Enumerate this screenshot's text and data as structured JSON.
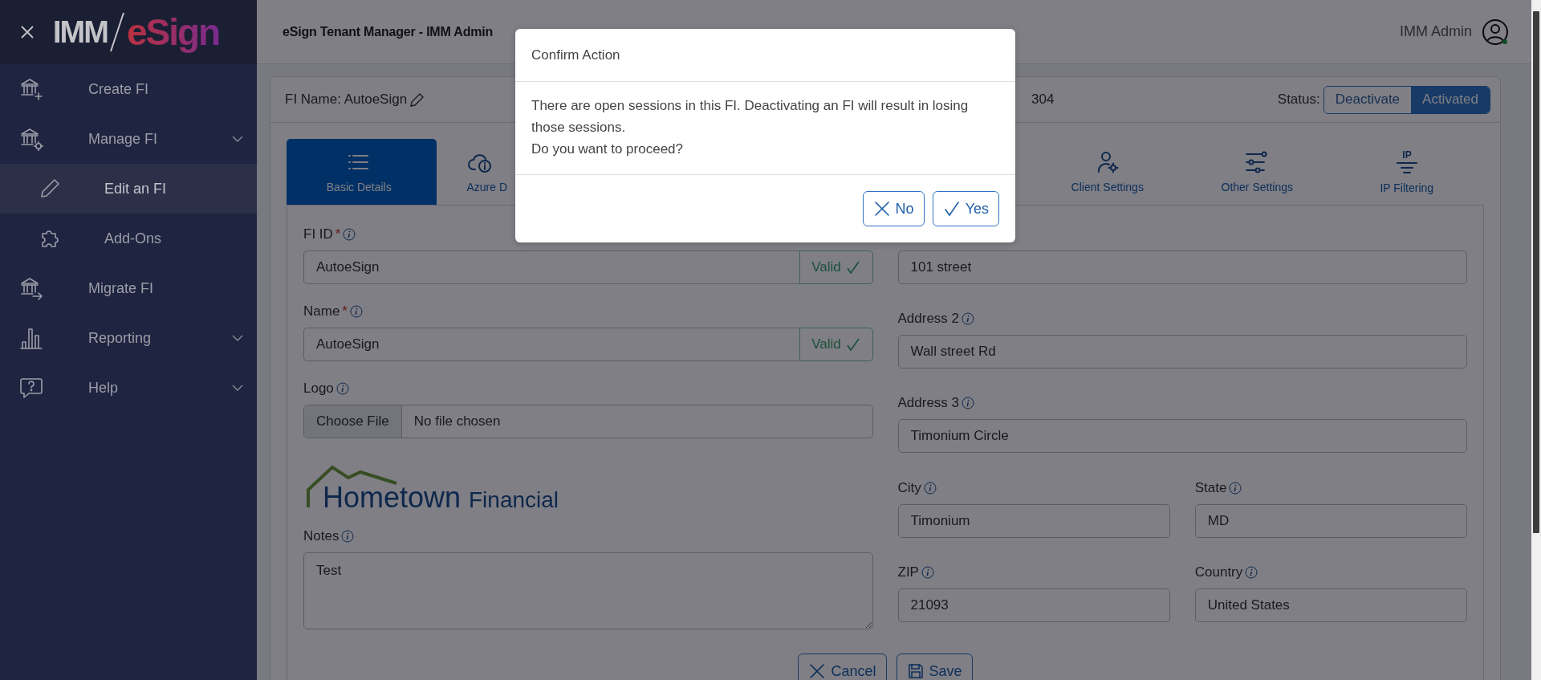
{
  "sidebar": {
    "logo": {
      "part_1": "IMM",
      "part_2": "eSign"
    },
    "items": [
      {
        "label": "Create FI",
        "expandable": false,
        "selected": false
      },
      {
        "label": "Manage FI",
        "expandable": true,
        "selected": false,
        "children": [
          {
            "label": "Edit an FI",
            "selected": true
          },
          {
            "label": "Add-Ons",
            "selected": false
          }
        ]
      },
      {
        "label": "Migrate FI",
        "expandable": false,
        "selected": false
      },
      {
        "label": "Reporting",
        "expandable": true,
        "selected": false
      },
      {
        "label": "Help",
        "expandable": true,
        "selected": false
      }
    ]
  },
  "header": {
    "title": "eSign Tenant Manager - IMM Admin",
    "user": "IMM Admin"
  },
  "card": {
    "fi_name": "FI Name: AutoeSign",
    "number": "304",
    "status_label": "Status:",
    "status_options": [
      {
        "label": "Deactivate",
        "selected": false
      },
      {
        "label": "Activated",
        "selected": true
      }
    ]
  },
  "tabs": [
    {
      "label": "Basic Details",
      "selected": true
    },
    {
      "label": "Azure D",
      "selected": false
    },
    {
      "label": "Client Settings",
      "selected": false
    },
    {
      "label": "Other Settings",
      "selected": false
    },
    {
      "label": "IP Filtering",
      "icon_text": "IP",
      "selected": false
    }
  ],
  "form_left": [
    {
      "kind": "validated",
      "label": "FI ID",
      "mark": "*",
      "value": "AutoeSign",
      "status": "Valid"
    },
    {
      "kind": "validated",
      "label": "Name",
      "mark": "*",
      "value": "AutoeSign",
      "status": "Valid"
    },
    {
      "kind": "file",
      "label": "Logo",
      "button": "Choose File",
      "value": "No file chosen"
    },
    {
      "kind": "logo",
      "part_1": "Hometown",
      "part_2": "Financial"
    },
    {
      "kind": "textarea",
      "label": "Notes",
      "value": "Test"
    }
  ],
  "form_right": [
    {
      "kind": "text",
      "value": "101 street"
    },
    {
      "kind": "text",
      "label": "Address 2",
      "value": "Wall street Rd"
    },
    {
      "kind": "text",
      "label": "Address 3",
      "value": "Timonium Circle"
    },
    {
      "kind": "text",
      "label": "City",
      "value": "Timonium"
    },
    {
      "kind": "text",
      "label": "State",
      "value": "MD"
    },
    {
      "kind": "text",
      "label": "ZIP",
      "value": "21093"
    },
    {
      "kind": "text",
      "label": "Country",
      "value": "United States"
    }
  ],
  "actions": [
    {
      "label": "Cancel"
    },
    {
      "label": "Save"
    }
  ],
  "dialog": {
    "title": "Confirm Action",
    "message": [
      "There are open sessions in this FI. Deactivating an FI will result in losing those sessions.",
      "Do you want to proceed?"
    ],
    "buttons": [
      {
        "label": "No"
      },
      {
        "label": "Yes"
      }
    ]
  }
}
